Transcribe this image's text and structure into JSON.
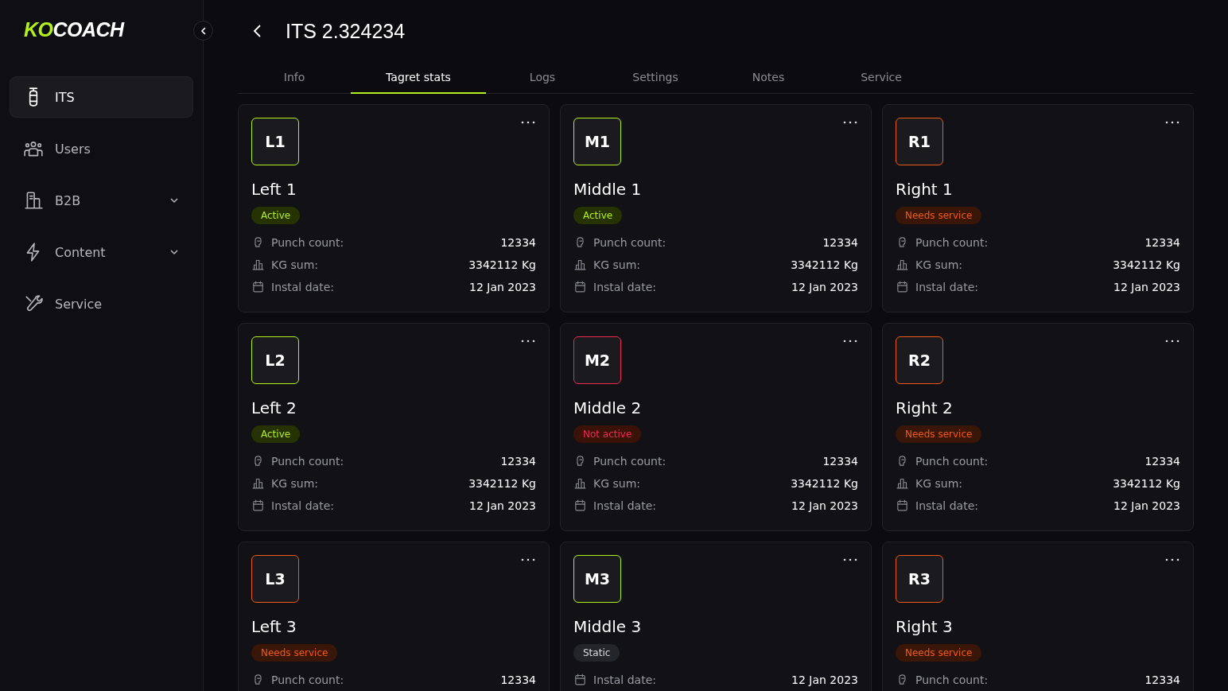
{
  "logo": {
    "accent": "KO",
    "rest": "COACH"
  },
  "sidebar": {
    "items": [
      {
        "label": "ITS",
        "kind": "bag",
        "selected": true,
        "expandable": false
      },
      {
        "label": "Users",
        "kind": "users",
        "selected": false,
        "expandable": false
      },
      {
        "label": "B2B",
        "kind": "building",
        "selected": false,
        "expandable": true
      },
      {
        "label": "Content",
        "kind": "bolt",
        "selected": false,
        "expandable": true
      },
      {
        "label": "Service",
        "kind": "wrench",
        "selected": false,
        "expandable": false
      }
    ]
  },
  "header": {
    "title": "ITS 2.324234"
  },
  "tabs": [
    {
      "label": "Info",
      "selected": false
    },
    {
      "label": "Tagret stats",
      "selected": true
    },
    {
      "label": "Logs",
      "selected": false
    },
    {
      "label": "Settings",
      "selected": false
    },
    {
      "label": "Notes",
      "selected": false
    },
    {
      "label": "Service",
      "selected": false
    }
  ],
  "cards": [
    {
      "code": "L1",
      "name": "Left 1",
      "status": {
        "kind": "active",
        "label": "Active"
      },
      "stats": [
        {
          "kind": "punch",
          "label": "Punch count:",
          "value": "12334"
        },
        {
          "kind": "kg",
          "label": "KG sum:",
          "value": "3342112 Kg"
        },
        {
          "kind": "date",
          "label": "Instal date:",
          "value": "12 Jan 2023"
        }
      ]
    },
    {
      "code": "M1",
      "name": "Middle 1",
      "status": {
        "kind": "active",
        "label": "Active"
      },
      "stats": [
        {
          "kind": "punch",
          "label": "Punch count:",
          "value": "12334"
        },
        {
          "kind": "kg",
          "label": "KG sum:",
          "value": "3342112 Kg"
        },
        {
          "kind": "date",
          "label": "Instal date:",
          "value": "12 Jan 2023"
        }
      ]
    },
    {
      "code": "R1",
      "name": "Right 1",
      "status": {
        "kind": "service",
        "label": "Needs service"
      },
      "stats": [
        {
          "kind": "punch",
          "label": "Punch count:",
          "value": "12334"
        },
        {
          "kind": "kg",
          "label": "KG sum:",
          "value": "3342112 Kg"
        },
        {
          "kind": "date",
          "label": "Instal date:",
          "value": "12 Jan 2023"
        }
      ]
    },
    {
      "code": "L2",
      "name": "Left 2",
      "status": {
        "kind": "active",
        "label": "Active"
      },
      "stats": [
        {
          "kind": "punch",
          "label": "Punch count:",
          "value": "12334"
        },
        {
          "kind": "kg",
          "label": "KG sum:",
          "value": "3342112 Kg"
        },
        {
          "kind": "date",
          "label": "Instal date:",
          "value": "12 Jan 2023"
        }
      ]
    },
    {
      "code": "M2",
      "name": "Middle 2",
      "status": {
        "kind": "inactive",
        "label": "Not active"
      },
      "stats": [
        {
          "kind": "punch",
          "label": "Punch count:",
          "value": "12334"
        },
        {
          "kind": "kg",
          "label": "KG sum:",
          "value": "3342112 Kg"
        },
        {
          "kind": "date",
          "label": "Instal date:",
          "value": "12 Jan 2023"
        }
      ]
    },
    {
      "code": "R2",
      "name": "Right 2",
      "status": {
        "kind": "service",
        "label": "Needs service"
      },
      "stats": [
        {
          "kind": "punch",
          "label": "Punch count:",
          "value": "12334"
        },
        {
          "kind": "kg",
          "label": "KG sum:",
          "value": "3342112 Kg"
        },
        {
          "kind": "date",
          "label": "Instal date:",
          "value": "12 Jan 2023"
        }
      ]
    },
    {
      "code": "L3",
      "name": "Left 3",
      "status": {
        "kind": "service",
        "label": "Needs service"
      },
      "stats": [
        {
          "kind": "punch",
          "label": "Punch count:",
          "value": "12334"
        }
      ]
    },
    {
      "code": "M3",
      "name": "Middle 3",
      "status": {
        "kind": "static",
        "label": "Static"
      },
      "stats": [
        {
          "kind": "date",
          "label": "Instal date:",
          "value": "12 Jan 2023"
        }
      ]
    },
    {
      "code": "R3",
      "name": "Right 3",
      "status": {
        "kind": "service",
        "label": "Needs service"
      },
      "stats": [
        {
          "kind": "punch",
          "label": "Punch count:",
          "value": "12334"
        }
      ]
    }
  ]
}
